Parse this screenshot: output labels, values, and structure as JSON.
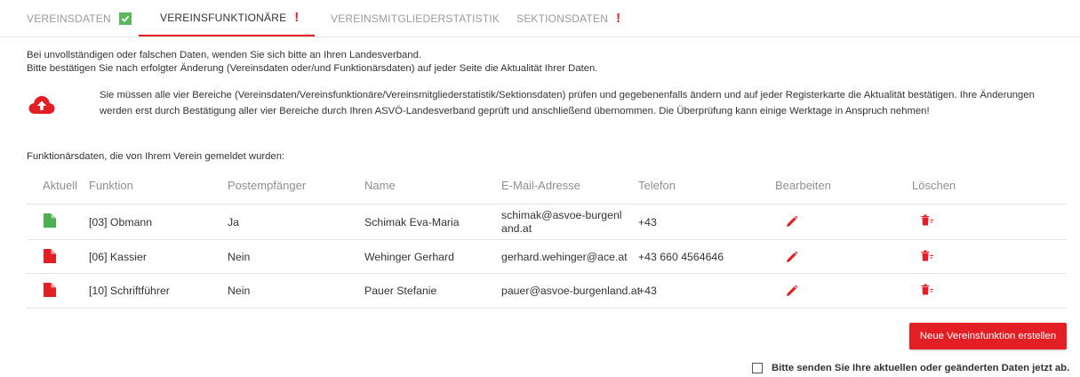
{
  "tabs": [
    {
      "label": "Vereinsdaten",
      "status": "ok"
    },
    {
      "label": "Vereinsfunktionäre",
      "status": "warning"
    },
    {
      "label": "Vereinsmitgliederstatistik",
      "status": "none"
    },
    {
      "label": "Sektionsdaten",
      "status": "warning"
    }
  ],
  "notice": {
    "line1": "Bei unvollständigen oder falschen Daten, wenden Sie sich bitte an Ihren Landesverband.",
    "line2": "Bitte bestätigen Sie nach erfolgter Änderung (Vereinsdaten oder/und Funktionärsdaten) auf jeder Seite die Aktualität Ihrer Daten."
  },
  "info": {
    "icon": "cloud-upload-icon",
    "text": "Sie müssen alle vier Bereiche (Vereinsdaten/Vereinsfunktionäre/Vereinsmitgliederstatistik/Sektionsdaten) prüfen und gegebenenfalls ändern und auf jeder Registerkarte die Aktualität bestätigen. Ihre Änderungen werden erst durch Bestätigung aller vier Bereiche durch Ihren ASVÖ-Landesverband geprüft und anschließend übernommen. Die Überprüfung kann einige Werktage in Anspruch nehmen!"
  },
  "table": {
    "caption": "Funktionärsdaten, die von Ihrem Verein gemeldet wurden:",
    "headers": {
      "aktuell": "Aktuell",
      "funktion": "Funktion",
      "postempfaenger": "Postempfänger",
      "name": "Name",
      "email": "E-Mail-Adresse",
      "telefon": "Telefon",
      "bearbeiten": "Bearbeiten",
      "loeschen": "Löschen"
    },
    "rows": [
      {
        "aktuell": "current",
        "funktion": "[03] Obmann",
        "postempfaenger": "Ja",
        "name": "Schimak Eva-Maria",
        "email": "schimak@asvoe-burgenland.at",
        "telefon": "+43"
      },
      {
        "aktuell": "outdated",
        "funktion": "[06] Kassier",
        "postempfaenger": "Nein",
        "name": "Wehinger Gerhard",
        "email": "gerhard.wehinger@ace.at",
        "telefon": "+43 660 4564646"
      },
      {
        "aktuell": "outdated",
        "funktion": "[10] Schriftführer",
        "postempfaenger": "Nein",
        "name": "Pauer Stefanie",
        "email": "pauer@asvoe-burgenland.at",
        "telefon": "+43"
      }
    ]
  },
  "actions": {
    "new_button": "Neue Vereinsfunktion erstellen",
    "send_label": "Bitte senden Sie Ihre aktuellen oder geänderten Daten jetzt ab."
  },
  "colors": {
    "accent": "#e31e24",
    "ok": "#5cb85c",
    "current": "#4caf50",
    "outdated": "#e31e24"
  }
}
